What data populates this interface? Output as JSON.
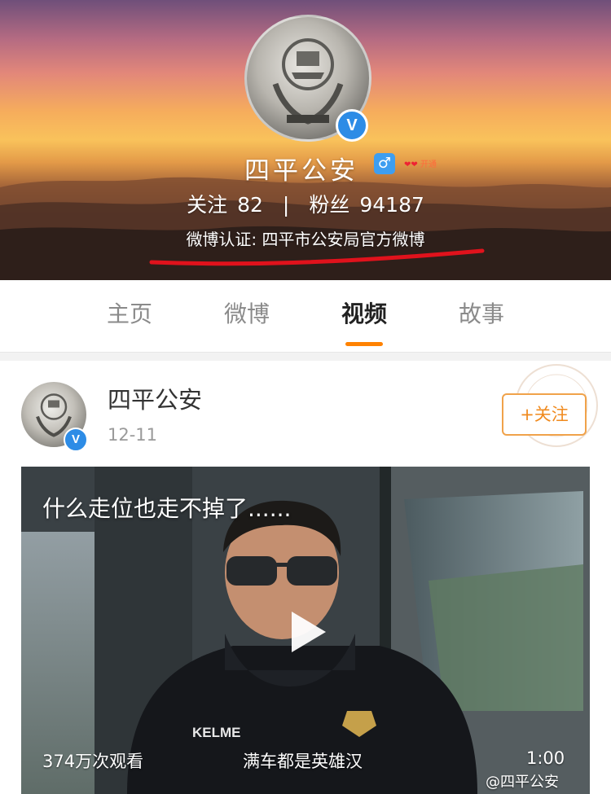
{
  "profile": {
    "name": "四平公安",
    "gender_icon": "male-icon",
    "member_badge": "开通",
    "verified_icon": "verified-v-icon",
    "following_label": "关注",
    "following_count": "82",
    "separator": "|",
    "followers_label": "粉丝",
    "followers_count": "94187",
    "verification": "微博认证: 四平市公安局官方微博"
  },
  "tabs": [
    {
      "label": "主页",
      "active": false
    },
    {
      "label": "微博",
      "active": false
    },
    {
      "label": "视频",
      "active": true
    },
    {
      "label": "故事",
      "active": false
    }
  ],
  "post": {
    "author": "四平公安",
    "time": "12-11",
    "follow_label": "+关注",
    "video": {
      "title": "什么走位也走不掉了......",
      "views": "374万次观看",
      "subtitle": "满车都是英雄汉",
      "duration": "1:00",
      "jacket_brand": "KELME"
    }
  },
  "watermark": "@四平公安",
  "colors": {
    "accent_orange": "#ff8200",
    "verified_blue": "#2d8ce6",
    "underline_red": "#e0121c"
  }
}
